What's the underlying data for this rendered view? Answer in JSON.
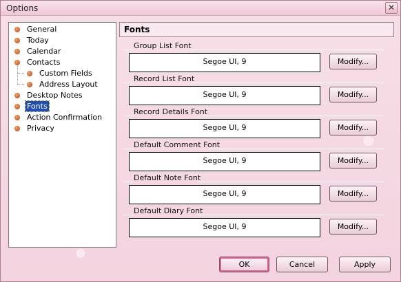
{
  "window": {
    "title": "Options",
    "close_glyph": "✕"
  },
  "tree": {
    "items": [
      {
        "label": "General",
        "level": 0
      },
      {
        "label": "Today",
        "level": 0
      },
      {
        "label": "Calendar",
        "level": 0
      },
      {
        "label": "Contacts",
        "level": 0
      },
      {
        "label": "Custom Fields",
        "level": 1
      },
      {
        "label": "Address Layout",
        "level": 1
      },
      {
        "label": "Desktop Notes",
        "level": 0
      },
      {
        "label": "Fonts",
        "level": 0,
        "selected": true
      },
      {
        "label": "Action Confirmation",
        "level": 0
      },
      {
        "label": "Privacy",
        "level": 0
      }
    ]
  },
  "panel": {
    "header": "Fonts",
    "sections": [
      {
        "title": "Group List Font",
        "value": "Segoe UI, 9",
        "button": "Modify..."
      },
      {
        "title": "Record List Font",
        "value": "Segoe UI, 9",
        "button": "Modify..."
      },
      {
        "title": "Record Details Font",
        "value": "Segoe UI, 9",
        "button": "Modify..."
      },
      {
        "title": "Default Comment Font",
        "value": "Segoe UI, 9",
        "button": "Modify..."
      },
      {
        "title": "Default Note Font",
        "value": "Segoe UI, 9",
        "button": "Modify..."
      },
      {
        "title": "Default Diary Font",
        "value": "Segoe UI, 9",
        "button": "Modify..."
      }
    ]
  },
  "footer": {
    "ok_label": "OK",
    "cancel_label": "Cancel",
    "apply_label": "Apply"
  },
  "colors": {
    "selection": "#1f4fb0",
    "ok_highlight": "#e55b8e",
    "background": "#f4d6e0"
  }
}
